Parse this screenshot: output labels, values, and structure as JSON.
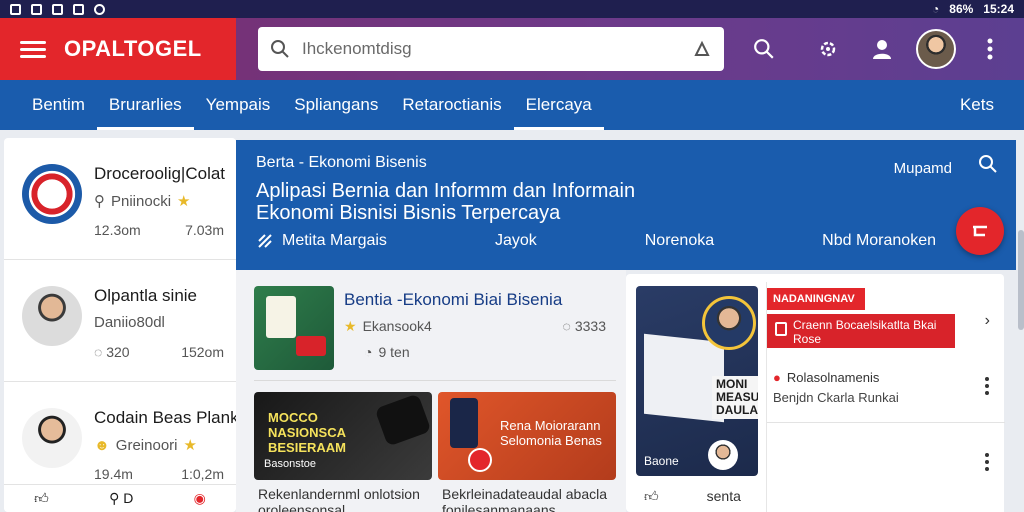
{
  "status_bar": {
    "battery": "86%",
    "time": "15:24"
  },
  "header": {
    "brand": "OPALTOGEL",
    "search_placeholder": "Ihckenomtdisg",
    "accent": "#e3262b"
  },
  "tabs": [
    {
      "label": "Bentim"
    },
    {
      "label": "Brurarlies"
    },
    {
      "label": "Yempais"
    },
    {
      "label": "Spliangans"
    },
    {
      "label": "Retaroctianis"
    },
    {
      "label": "Elercaya"
    }
  ],
  "tab_right": "Kets",
  "left_list": [
    {
      "title": "Droceroolig|Colat",
      "sub": "Pniinocki",
      "meta_left": "12.3om",
      "meta_right": "7.03m"
    },
    {
      "title": "Olpantla sinie",
      "sub": "Daniio80dl",
      "meta_left": "320",
      "meta_right": "152om"
    },
    {
      "title": "Codain Beas Planke",
      "sub": "Greinoori",
      "meta_left": "19.4m",
      "meta_right": "1:0,2m"
    }
  ],
  "left_bottom": {
    "item2": "D"
  },
  "hero": {
    "breadcrumb": "Berta - Ekonomi Bisenis",
    "title": "Aplipasi Bernia dan Informm dan Informain Ekonomi Bisnisi Bisnis Terpercaya",
    "manage": "Mupamd",
    "links": [
      "Metita Margais",
      "Jayok",
      "Norenoka",
      "Nbd Moranoken"
    ]
  },
  "featured": {
    "title": "Bentia -Ekonomi Biai Bisenia",
    "author": "Ekansook4",
    "count": "3333",
    "time": "9 ten"
  },
  "cards": [
    {
      "headline": "MOCCO NASIONSCA BESIERAAM",
      "foot": "Basonstoe"
    },
    {
      "headline": "Rena Moiorarann Selomonia Benas"
    }
  ],
  "captions": [
    "Rekenlandernml onlotsion oroleensonsal",
    "Bekrleinadateaudal abacla fonilesanmanaans"
  ],
  "right_card": {
    "image_text": "MONI MEASUU DAULAI",
    "image_caption": "Baone",
    "bottom_label": "senta"
  },
  "right_panel": {
    "badge": "NADANINGNAV",
    "red_text": "Craenn Bocaelsikatlta Bkai Rose",
    "line1": "Rolasolnamenis",
    "line2": "Benjdn Ckarla Runkai"
  }
}
